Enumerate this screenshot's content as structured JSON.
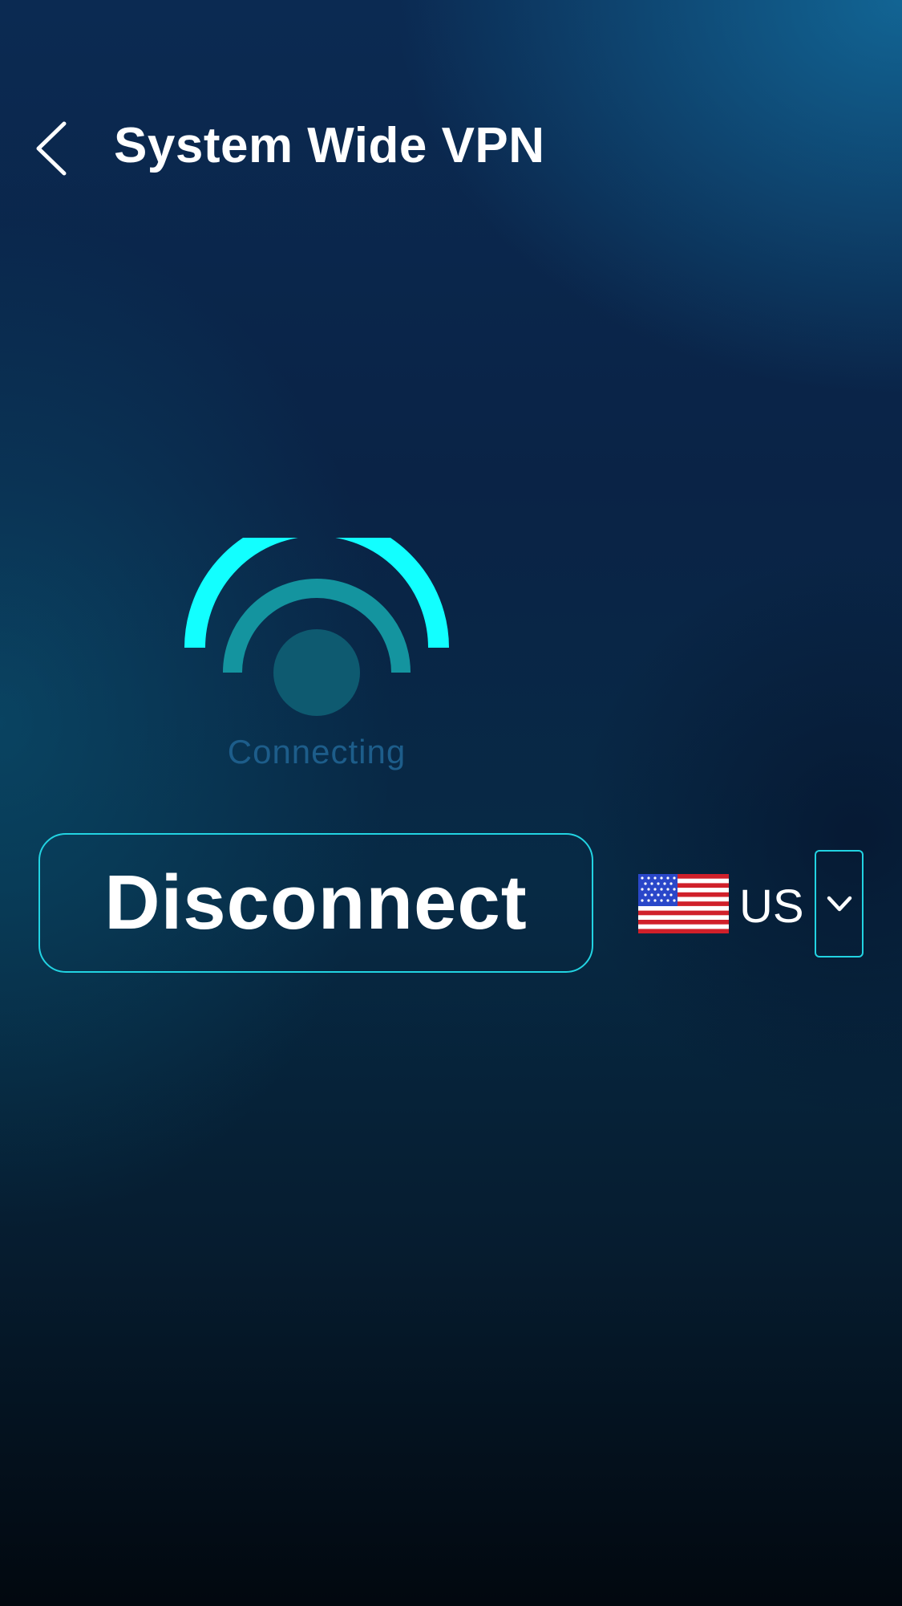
{
  "header": {
    "title": "System Wide VPN",
    "back_icon": "chevron-left-icon"
  },
  "status": {
    "text": "Connecting",
    "icon": "signal-arcs-icon"
  },
  "action": {
    "disconnect_label": "Disconnect"
  },
  "location": {
    "country_code": "US",
    "flag_icon": "us-flag-icon",
    "dropdown_icon": "chevron-down-icon"
  },
  "colors": {
    "accent": "#12FFFF",
    "accent_mid": "#14949F",
    "indicator_core": "#0E5A70",
    "status_text": "#1D5D8A",
    "border": "#22D3E2",
    "text_primary": "#FFFFFF"
  }
}
